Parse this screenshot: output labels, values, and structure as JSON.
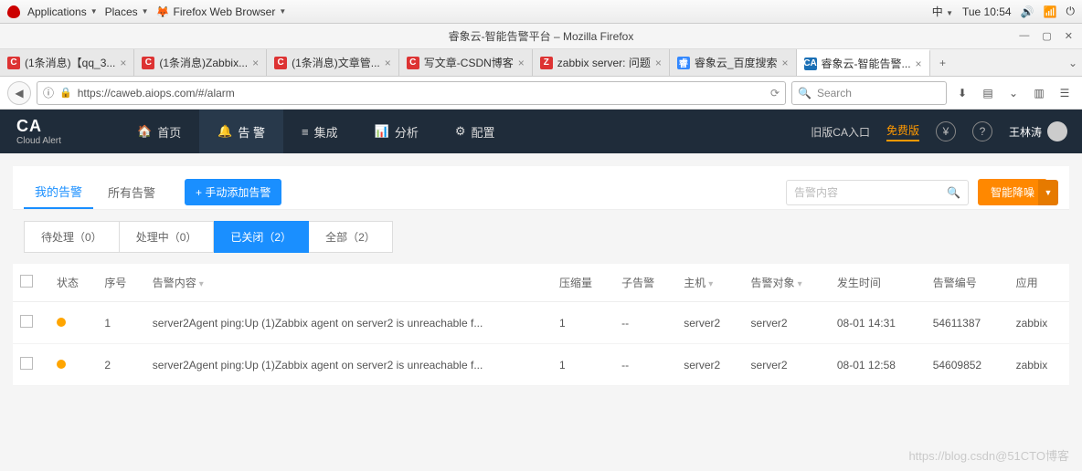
{
  "gnome": {
    "applications": "Applications",
    "places": "Places",
    "app_label": "Firefox Web Browser",
    "lang": "中",
    "clock": "Tue 10:54"
  },
  "window_title": "睿象云-智能告警平台 – Mozilla Firefox",
  "tabs": [
    {
      "fav": "C",
      "cls": "fav-c",
      "label": "(1条消息)【qq_3..."
    },
    {
      "fav": "C",
      "cls": "fav-c",
      "label": "(1条消息)Zabbix..."
    },
    {
      "fav": "C",
      "cls": "fav-c",
      "label": "(1条消息)文章管..."
    },
    {
      "fav": "C",
      "cls": "fav-c",
      "label": "写文章-CSDN博客"
    },
    {
      "fav": "Z",
      "cls": "fav-z",
      "label": "zabbix server: 问题"
    },
    {
      "fav": "睿",
      "cls": "fav-b",
      "label": "睿象云_百度搜索"
    },
    {
      "fav": "CA",
      "cls": "fav-ca",
      "label": "睿象云-智能告警...",
      "active": true
    }
  ],
  "url": "https://caweb.aiops.com/#/alarm",
  "search_placeholder": "Search",
  "ca": {
    "logo_big": "CA",
    "logo_small": "Cloud Alert",
    "nav": [
      {
        "icon": "🏠",
        "label": "首页"
      },
      {
        "icon": "🔔",
        "label": "告 警",
        "active": true
      },
      {
        "icon": "≡",
        "label": "集成"
      },
      {
        "icon": "📊",
        "label": "分析"
      },
      {
        "icon": "⚙",
        "label": "配置"
      }
    ],
    "old_link": "旧版CA入口",
    "free": "免费版",
    "pay_icon": "¥",
    "help_icon": "?",
    "username": "王林涛"
  },
  "subtabs": {
    "mine": "我的告警",
    "all": "所有告警",
    "add": "+ 手动添加告警"
  },
  "search_alarm_placeholder": "告警内容",
  "noise_btn": "智能降噪",
  "filters": [
    {
      "label": "待处理（0）"
    },
    {
      "label": "处理中（0）"
    },
    {
      "label": "已关闭（2）",
      "active": true
    },
    {
      "label": "全部（2）"
    }
  ],
  "columns": {
    "status": "状态",
    "seq": "序号",
    "content": "告警内容",
    "compress": "压缩量",
    "child": "子告警",
    "host": "主机",
    "target": "告警对象",
    "time": "发生时间",
    "id": "告警编号",
    "app": "应用"
  },
  "rows": [
    {
      "seq": "1",
      "content": "server2Agent ping:Up (1)Zabbix agent on server2 is unreachable f...",
      "compress": "1",
      "child": "--",
      "host": "server2",
      "target": "server2",
      "time": "08-01 14:31",
      "id": "54611387",
      "app": "zabbix"
    },
    {
      "seq": "2",
      "content": "server2Agent ping:Up (1)Zabbix agent on server2 is unreachable f...",
      "compress": "1",
      "child": "--",
      "host": "server2",
      "target": "server2",
      "time": "08-01 12:58",
      "id": "54609852",
      "app": "zabbix"
    }
  ],
  "watermark": "https://blog.csdn@51CTO博客"
}
